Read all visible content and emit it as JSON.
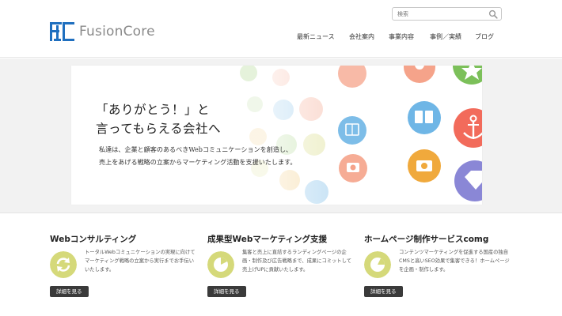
{
  "brand": {
    "name": "FusionCore",
    "accent": "#1f6fbf"
  },
  "search": {
    "placeholder": "検索",
    "icon": "search-icon"
  },
  "nav": {
    "items": [
      {
        "label": "最新ニュース"
      },
      {
        "label": "会社案内"
      },
      {
        "label": "事業内容"
      },
      {
        "label": "事例／実績"
      },
      {
        "label": "ブログ"
      }
    ]
  },
  "hero": {
    "title_line1": "「ありがとう！」と",
    "title_line2": "言ってもらえる会社へ",
    "text_line1": "私達は、企業と顧客のあるべきWebコミュニケーションを創造し、",
    "text_line2": "売上をあげる戦略の立案からマーケティング活動を支援いたします。",
    "icons": [
      "gift-icon",
      "star-icon",
      "heart-icon",
      "leaf-icon",
      "lightbulb-icon",
      "book-icon",
      "anchor-icon",
      "pie-chart-icon",
      "camera-icon",
      "diamond-icon",
      "cloud-icon"
    ]
  },
  "services": [
    {
      "title": "Webコンサルティング",
      "desc": "トータルWebコミュニケーションの実現に向けてマーケティング戦略の立案から実行までお手伝いいたします。",
      "button": "詳細を見る",
      "icon": "refresh-icon",
      "color": "#d5d97a"
    },
    {
      "title": "成果型Webマーケティング支援",
      "desc": "集客と売上に直結するランディングページの企画・制作及び広告戦略まで、成果にコミットして売上げUPに貢献いたします。",
      "button": "詳細を見る",
      "icon": "pie-chart-icon",
      "color": "#d5d97a"
    },
    {
      "title": "ホームページ制作サービスcomg",
      "desc": "コンテンツマーケティングを促進する国産の独自CMSと高いSEO効果で集客できる！ホームページを企画・制作します。",
      "button": "詳細を見る",
      "icon": "pie-chart-icon",
      "color": "#d5d97a"
    }
  ]
}
